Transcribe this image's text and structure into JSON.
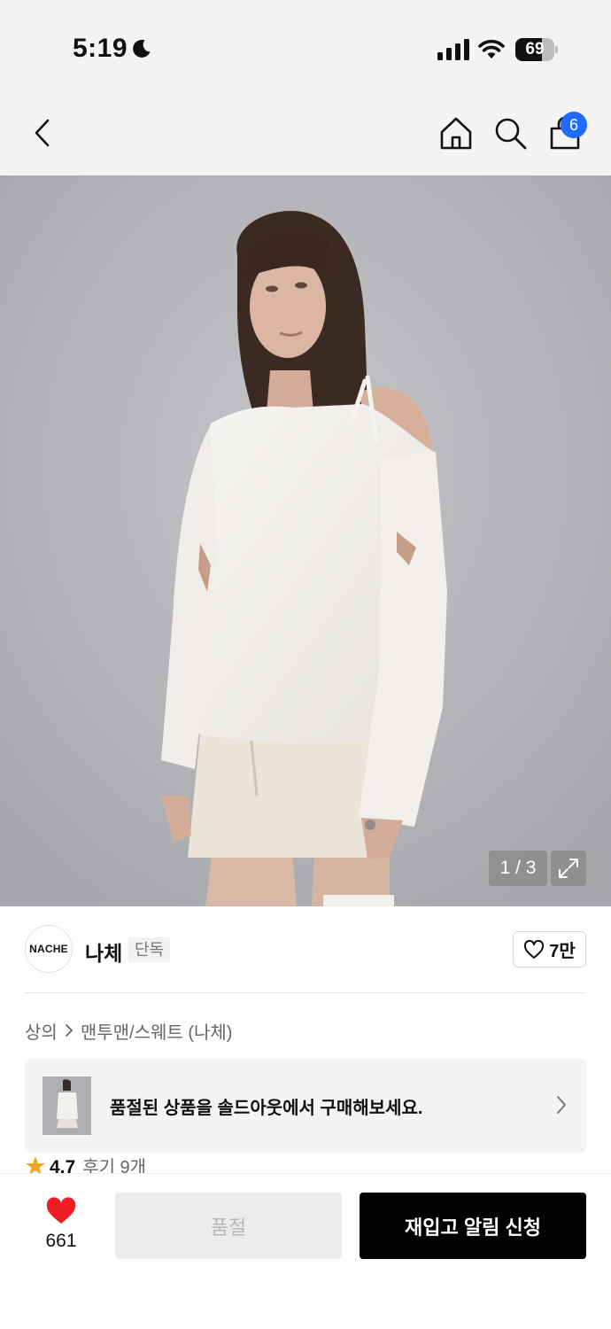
{
  "status_bar": {
    "time": "5:19",
    "battery_level": "69",
    "icons": [
      "moon-icon",
      "signal-icon",
      "wifi-icon",
      "battery-icon"
    ]
  },
  "nav": {
    "icons": [
      "back-icon",
      "home-icon",
      "search-icon",
      "shopping-bag-icon"
    ],
    "cart_badge": "6",
    "badge_color": "#1f6bff"
  },
  "gallery": {
    "counter": "1 / 3",
    "expand_icon": "expand-icon"
  },
  "brand": {
    "logo_text": "NACHE",
    "name": "나체",
    "badge": "단독",
    "like_count": "7만"
  },
  "breadcrumb": {
    "items": [
      "상의",
      "맨투맨/스웨트 (나체)"
    ]
  },
  "soldout_banner": {
    "text": "품절된 상품을 솔드아웃에서 구매해보세요."
  },
  "rating": {
    "score": "4.7",
    "reviews": "후기 9개",
    "star_color": "#f5a623"
  },
  "bottom_bar": {
    "wish_count": "661",
    "heart_color": "#ee1c25",
    "soldout_label": "품절",
    "restock_label": "재입고 알림 신청"
  }
}
